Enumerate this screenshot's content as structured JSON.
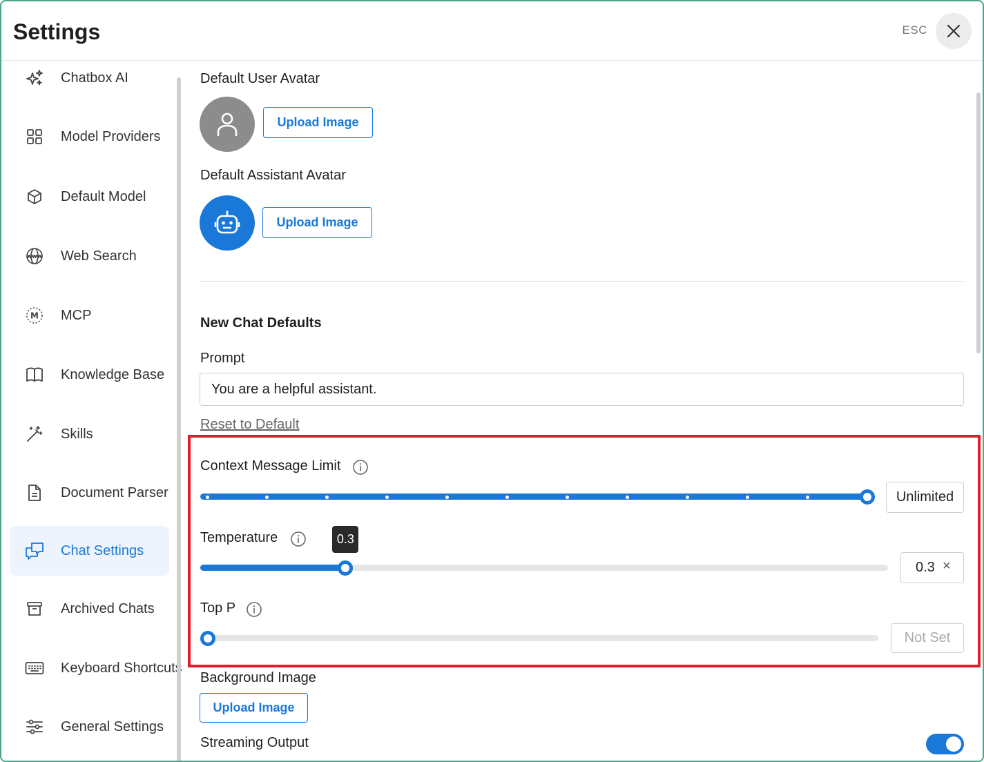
{
  "header": {
    "title": "Settings",
    "esc_label": "ESC"
  },
  "sidebar": {
    "items": [
      {
        "label": "Chatbox AI",
        "icon": "sparkles-icon"
      },
      {
        "label": "Model Providers",
        "icon": "grid-icon"
      },
      {
        "label": "Default Model",
        "icon": "cube-icon"
      },
      {
        "label": "Web Search",
        "icon": "www-globe-icon"
      },
      {
        "label": "MCP",
        "icon": "mcp-icon"
      },
      {
        "label": "Knowledge Base",
        "icon": "book-icon"
      },
      {
        "label": "Skills",
        "icon": "magic-wand-icon"
      },
      {
        "label": "Document Parser",
        "icon": "document-icon"
      },
      {
        "label": "Chat Settings",
        "icon": "chat-bubbles-icon",
        "active": true
      },
      {
        "label": "Archived Chats",
        "icon": "archive-box-icon"
      },
      {
        "label": "Keyboard Shortcuts",
        "icon": "keyboard-icon"
      },
      {
        "label": "General Settings",
        "icon": "sliders-icon"
      }
    ]
  },
  "main": {
    "user_avatar": {
      "label": "Default User Avatar",
      "button": "Upload Image",
      "icon": "user-icon"
    },
    "assistant_avatar": {
      "label": "Default Assistant Avatar",
      "button": "Upload Image",
      "icon": "robot-icon"
    },
    "new_chat_defaults": {
      "title": "New Chat Defaults",
      "prompt_label": "Prompt",
      "prompt_value": "You are a helpful assistant.",
      "reset_label": "Reset to Default"
    },
    "context_limit": {
      "label": "Context Message Limit",
      "value_text": "Unlimited",
      "fraction": 1.0,
      "steps": 12
    },
    "temperature": {
      "label": "Temperature",
      "tooltip": "0.3",
      "value_text": "0.3",
      "clear": "×",
      "value": 0.3,
      "max": 1.42
    },
    "top_p": {
      "label": "Top P",
      "value_text": "Not Set",
      "fraction": 0.0
    },
    "background_image": {
      "label": "Background Image",
      "button": "Upload Image"
    },
    "streaming_output": {
      "label": "Streaming Output",
      "enabled": true
    }
  },
  "colors": {
    "accent": "#1a78d8",
    "highlight": "#e01e2b",
    "active_bg": "#edf4fd"
  }
}
